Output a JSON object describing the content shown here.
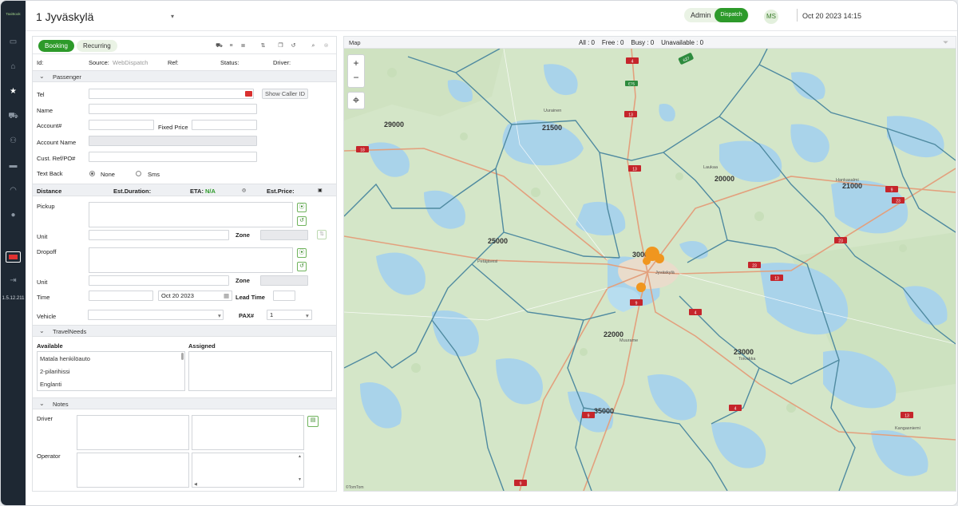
{
  "rail": {
    "logo": "TaxiBook",
    "version": "1.5.12.211",
    "items": [
      "monitor-icon",
      "home-icon",
      "star-icon",
      "car-icon",
      "driver-icon",
      "chat-icon",
      "gauge-icon",
      "circle-icon"
    ]
  },
  "header": {
    "location": "1 Jyväskylä",
    "role_admin": "Admin",
    "role_dispatch": "Dispatch",
    "avatar": "MS",
    "datetime": "Oct 20 2023 14:15"
  },
  "form": {
    "tabs": {
      "booking": "Booking",
      "recurring": "Recurring"
    },
    "meta": {
      "id": "Id:",
      "source": "Source:",
      "source_value": "WebDispatch",
      "ref": "Ref:",
      "status": "Status:",
      "driver": "Driver:"
    },
    "passenger": {
      "title": "Passenger",
      "tel": "Tel",
      "show_caller_id": "Show Caller ID",
      "name": "Name",
      "account": "Account#",
      "fixed_price": "Fixed Price",
      "account_name": "Account Name",
      "cust_ref": "Cust. Ref/PO#",
      "text_back": "Text Back",
      "none": "None",
      "sms": "Sms"
    },
    "trip": {
      "distance": "Distance",
      "est_duration": "Est.Duration:",
      "eta": "ETA:",
      "eta_value": "N/A",
      "est_price": "Est.Price:",
      "pickup": "Pickup",
      "unit": "Unit",
      "zone": "Zone",
      "dropoff": "Dropoff",
      "time": "Time",
      "date_value": "Oct 20 2023",
      "lead_time": "Lead Time",
      "vehicle": "Vehicle",
      "pax": "PAX#",
      "pax_value": "1"
    },
    "travel_needs": {
      "title": "TravelNeeds",
      "available": "Available",
      "assigned": "Assigned",
      "items": [
        "Matala henkilöauto",
        "2-pilarihissi",
        "Englanti"
      ]
    },
    "notes": {
      "title": "Notes",
      "driver": "Driver",
      "operator": "Operator"
    }
  },
  "map": {
    "title": "Map",
    "counts": "All : 0    Free : 0    Busy : 0    Unavailable : 0",
    "zoom_in": "+",
    "zoom_out": "−",
    "attribution": "©TomTom",
    "zones": [
      "29000",
      "21500",
      "20000",
      "21000",
      "25000",
      "30000",
      "22000",
      "23000",
      "35000"
    ],
    "places": [
      "Jyväskylä",
      "Petäjävesi",
      "Muurame",
      "Toivakka",
      "Laukaa",
      "Hankasalmi",
      "Kangasniemi",
      "Uurainen"
    ],
    "roads": [
      "4",
      "E75",
      "13",
      "18",
      "13",
      "9",
      "23",
      "23",
      "23",
      "13",
      "4",
      "9",
      "4",
      "9",
      "13",
      "637",
      "9"
    ],
    "colors": {
      "water": "#a9d3ea",
      "land": "#d4e6c8",
      "zone_border": "#4f8aa0",
      "road_badge": "#c5252b"
    }
  }
}
